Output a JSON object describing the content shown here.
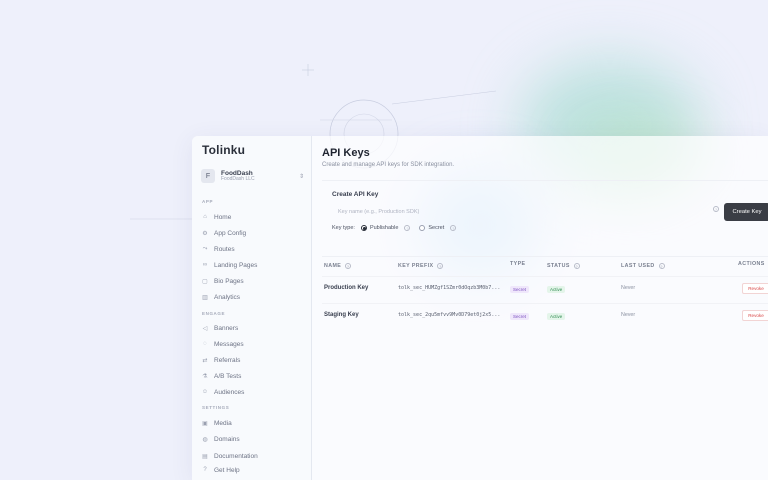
{
  "brand": {
    "logo": "Tolinku"
  },
  "org": {
    "initial": "F",
    "name": "FoodDash",
    "sub": "FoodDash LLC",
    "chevron": "⇕"
  },
  "sidebar": {
    "sections": {
      "app": "APP",
      "engage": "ENGAGE",
      "settings": "SETTINGS"
    },
    "items": [
      {
        "label": "Home",
        "icon": "home-icon"
      },
      {
        "label": "App Config",
        "icon": "gear-icon"
      },
      {
        "label": "Routes",
        "icon": "route-icon"
      },
      {
        "label": "Landing Pages",
        "icon": "link-icon"
      },
      {
        "label": "Bio Pages",
        "icon": "page-icon"
      },
      {
        "label": "Analytics",
        "icon": "chart-icon"
      },
      {
        "label": "Banners",
        "icon": "megaphone-icon"
      },
      {
        "label": "Messages",
        "icon": "message-icon"
      },
      {
        "label": "Referrals",
        "icon": "referral-icon"
      },
      {
        "label": "A/B Tests",
        "icon": "flask-icon"
      },
      {
        "label": "Audiences",
        "icon": "users-icon"
      },
      {
        "label": "Media",
        "icon": "image-icon"
      },
      {
        "label": "Domains",
        "icon": "globe-icon"
      },
      {
        "label": "Documentation",
        "icon": "book-icon"
      },
      {
        "label": "Get Help",
        "icon": "help-icon"
      }
    ]
  },
  "page": {
    "title": "API Keys",
    "subtitle": "Create and manage API keys for SDK integration."
  },
  "create": {
    "title": "Create API Key",
    "input_placeholder": "Key name (e.g., Production SDK)",
    "key_type_label": "Key type:",
    "options": [
      "Publishable",
      "Secret"
    ],
    "selected": "Publishable",
    "button_label": "Create Key"
  },
  "table": {
    "headers": [
      "NAME",
      "KEY PREFIX",
      "TYPE",
      "STATUS",
      "LAST USED",
      "ACTIONS"
    ],
    "rows": [
      {
        "name": "Production Key",
        "prefix": "tolk_sec_HUMZgf1SZmr0dOqzb3M0b7...",
        "type": "Secret",
        "status": "Active",
        "last_used": "Never",
        "action": "Revoke"
      },
      {
        "name": "Staging Key",
        "prefix": "tolk_sec_2qu5mfvv9Mv0D79et0j2x5...",
        "type": "Secret",
        "status": "Active",
        "last_used": "Never",
        "action": "Revoke"
      }
    ]
  },
  "colors": {
    "accent": "#3a3d45",
    "secret": "#7b4fc0",
    "active": "#2f8a50",
    "revoke": "#d94848"
  }
}
